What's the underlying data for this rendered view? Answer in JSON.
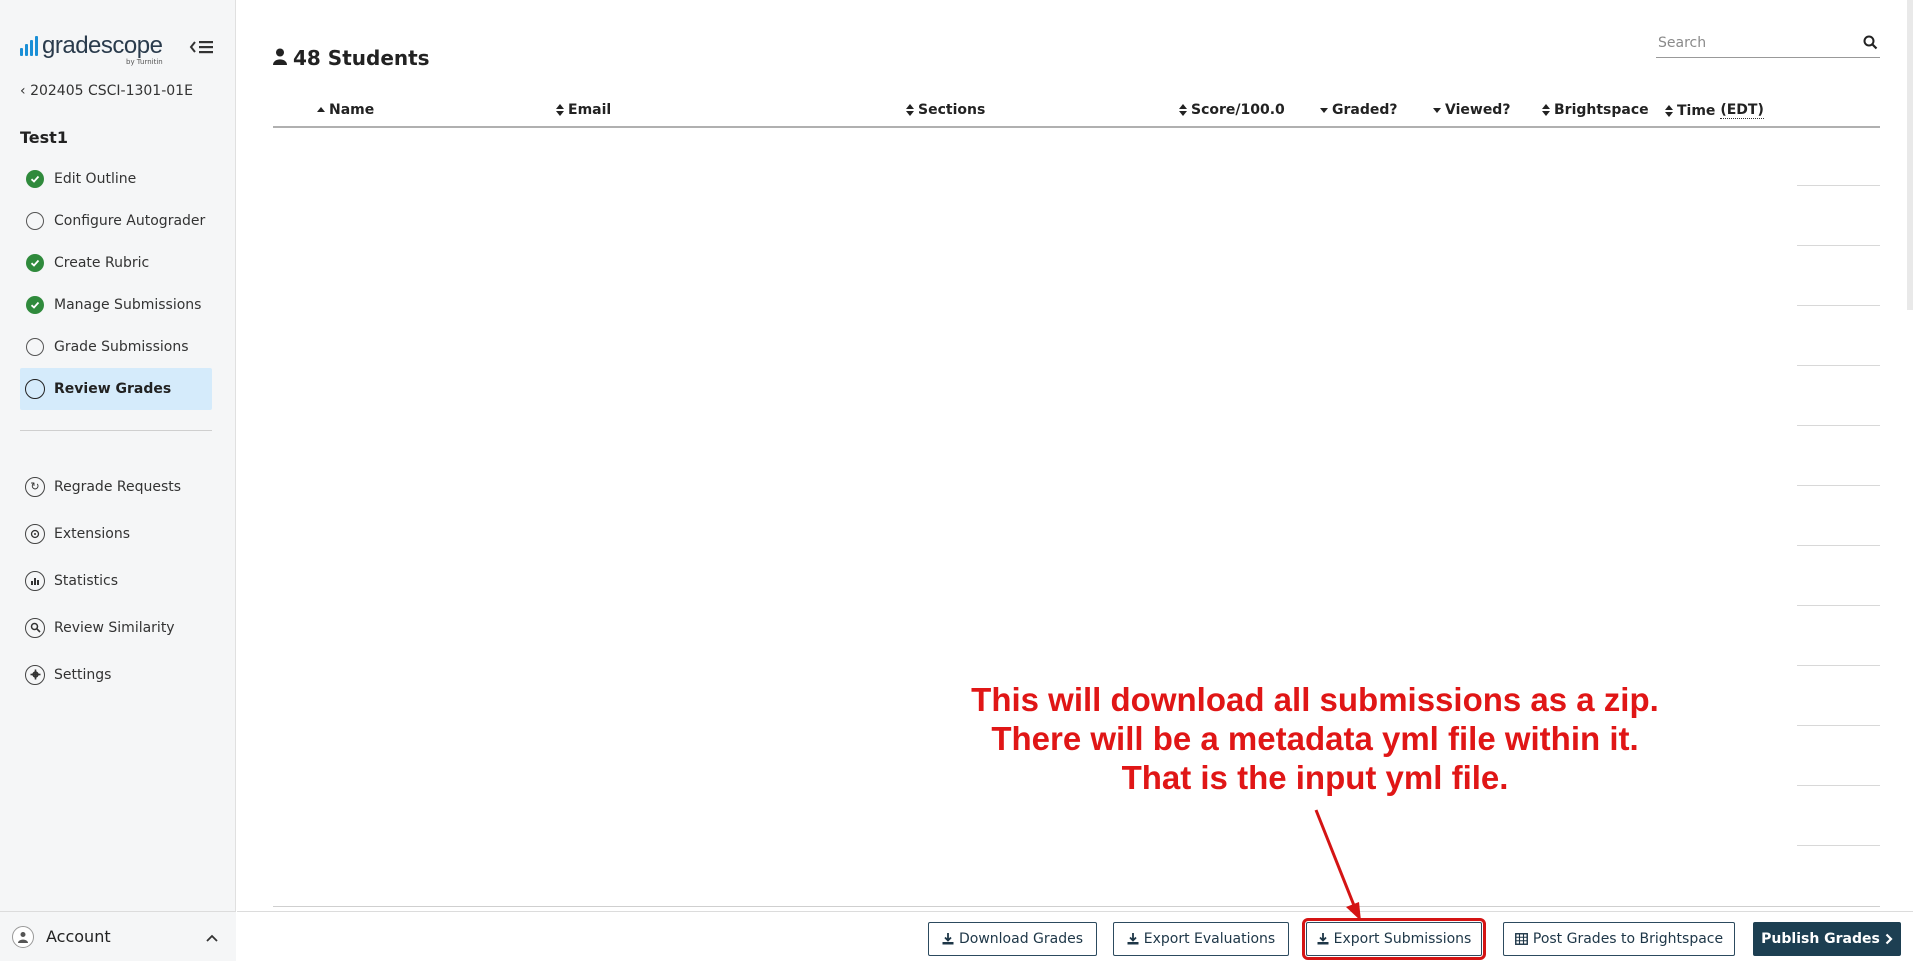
{
  "sidebar": {
    "logo_text": "gradescope",
    "logo_sub": "by Turnitin",
    "course_link": "202405 CSCI-1301-01E",
    "assignment_title": "Test1",
    "workflow": [
      {
        "label": "Edit Outline",
        "status": "done"
      },
      {
        "label": "Configure Autograder",
        "status": "todo"
      },
      {
        "label": "Create Rubric",
        "status": "done"
      },
      {
        "label": "Manage Submissions",
        "status": "done"
      },
      {
        "label": "Grade Submissions",
        "status": "todo"
      },
      {
        "label": "Review Grades",
        "status": "active"
      }
    ],
    "tools": [
      {
        "label": "Regrade Requests",
        "icon": "refresh-icon"
      },
      {
        "label": "Extensions",
        "icon": "clock-icon"
      },
      {
        "label": "Statistics",
        "icon": "bar-chart-icon"
      },
      {
        "label": "Review Similarity",
        "icon": "magnifier-icon"
      },
      {
        "label": "Settings",
        "icon": "gear-icon"
      }
    ],
    "account_label": "Account"
  },
  "main": {
    "students_title": "48 Students",
    "search": {
      "placeholder": "Search"
    },
    "columns": {
      "name": "Name",
      "email": "Email",
      "sections": "Sections",
      "score": "Score/100.0",
      "graded": "Graded?",
      "viewed": "Viewed?",
      "brightspace": "Brightspace",
      "time_label": "Time",
      "time_zone": "(EDT)"
    }
  },
  "footer": {
    "download_grades": "Download Grades",
    "export_evaluations": "Export Evaluations",
    "export_submissions": "Export Submissions",
    "post_grades": "Post Grades to Brightspace",
    "publish_grades": "Publish Grades"
  },
  "annotation": {
    "line1": "This will download all submissions as a zip.",
    "line2": "There will be a metadata yml file within it.",
    "line3": "That is the input yml file.",
    "color": "#e01616"
  },
  "colors": {
    "accent": "#1d3f52",
    "check_green": "#2f8a3c",
    "active_bg": "#d5ebfb",
    "logo_blue": "#1a8fd6"
  }
}
